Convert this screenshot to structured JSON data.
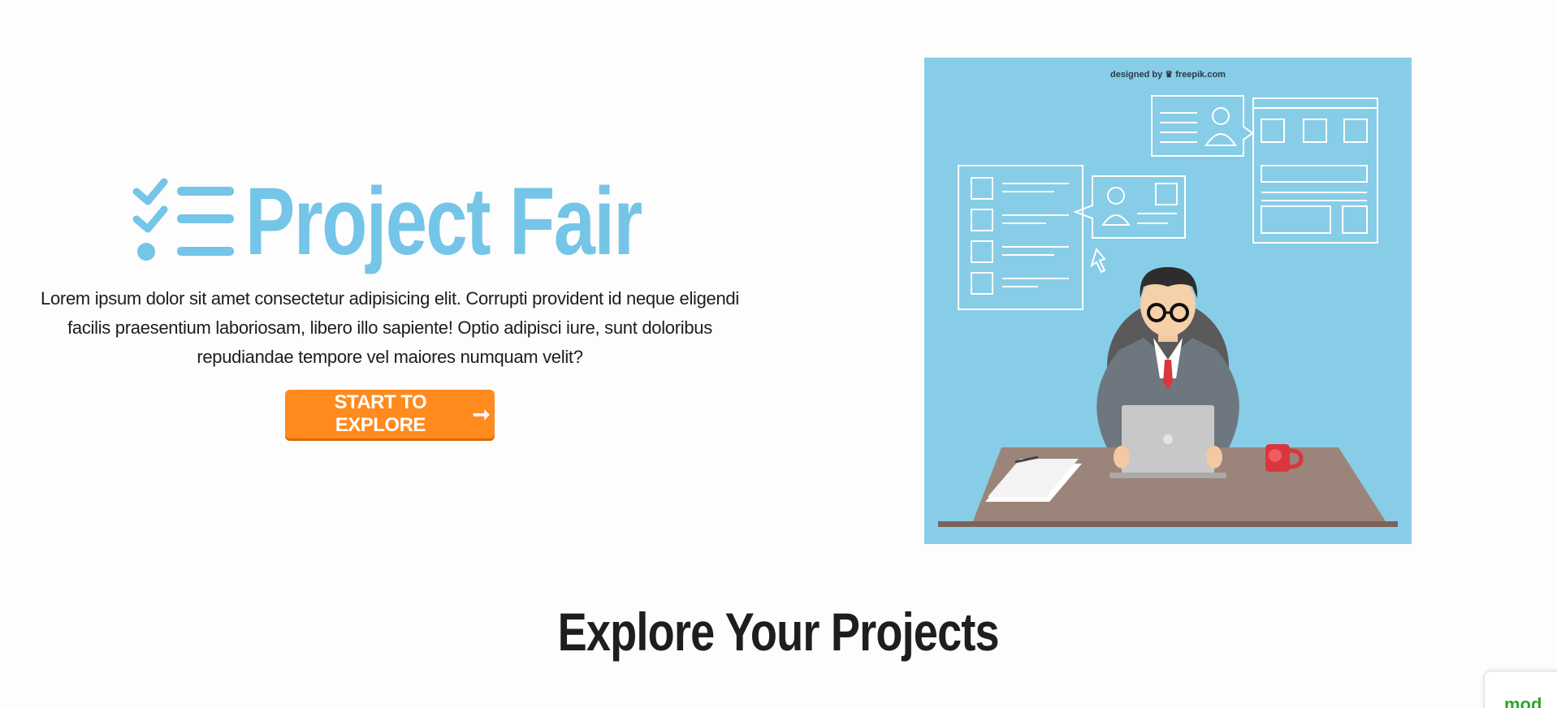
{
  "hero": {
    "title": "Project Fair",
    "description": "Lorem ipsum dolor sit amet consectetur adipisicing elit. Corrupti provident id neque eligendi facilis praesentium laboriosam, libero illo sapiente! Optio adipisci iure, sunt doloribus repudiandae tempore vel maiores numquam velit?",
    "cta_label": "START TO EXPLORE",
    "cta_arrow": "➞",
    "brand_icon": "checklist-icon",
    "accent_color": "#74c5e8",
    "cta_color": "#ff8a1e"
  },
  "illustration": {
    "credit_prefix": "designed by",
    "credit_site": "freepik.com",
    "background": "#87cde7"
  },
  "section": {
    "title": "Explore Your Projects"
  },
  "corner_widget": {
    "label": "mod"
  }
}
